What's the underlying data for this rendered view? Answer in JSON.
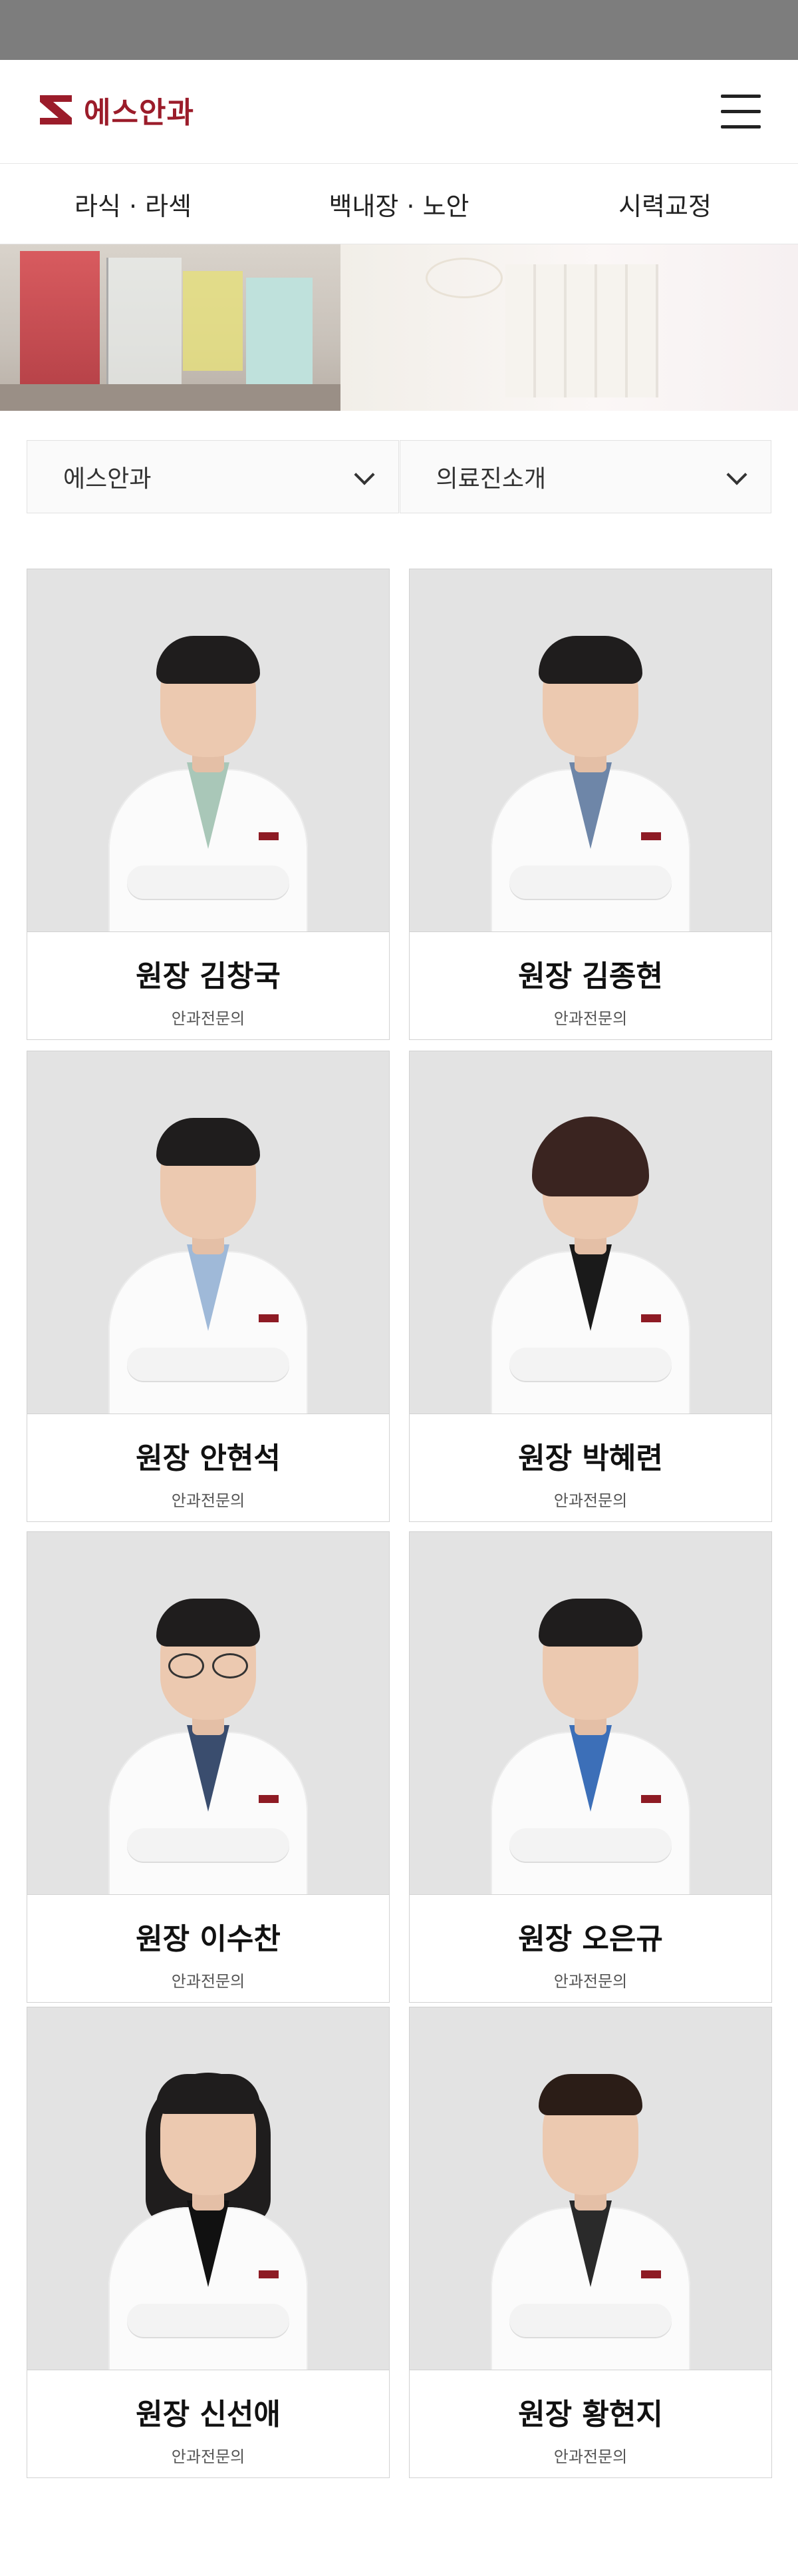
{
  "header": {
    "logo_text": "에스안과",
    "logo_icon": "s-logo-icon",
    "menu_icon": "hamburger-menu-icon"
  },
  "nav": {
    "items": [
      {
        "label": "라식 · 라섹"
      },
      {
        "label": "백내장 · 노안"
      },
      {
        "label": "시력교정"
      }
    ]
  },
  "banner": {
    "image": "clinic-interior-banner"
  },
  "selectors": {
    "hospital": "에스안과",
    "section": "의료진소개"
  },
  "doctors": [
    {
      "name": "원장 김창국",
      "specialty": "안과전문의",
      "shirt": "#a9c7b8",
      "hair": "short"
    },
    {
      "name": "원장 김종현",
      "specialty": "안과전문의",
      "shirt": "#6e86a8",
      "hair": "short"
    },
    {
      "name": "원장 안현석",
      "specialty": "안과전문의",
      "shirt": "#9fb9d8",
      "hair": "short"
    },
    {
      "name": "원장 박혜련",
      "specialty": "안과전문의",
      "shirt": "#1a1a1a",
      "hair": "bob"
    },
    {
      "name": "원장 이수찬",
      "specialty": "안과전문의",
      "shirt": "#3a4d6e",
      "hair": "short-glasses"
    },
    {
      "name": "원장 오은규",
      "specialty": "안과전문의",
      "shirt": "#3c6fb8",
      "hair": "short"
    },
    {
      "name": "원장 신선애",
      "specialty": "안과전문의",
      "shirt": "#111111",
      "hair": "long"
    },
    {
      "name": "원장 황현지",
      "specialty": "안과전문의",
      "shirt": "#2a2a2a",
      "hair": "bun"
    }
  ],
  "colors": {
    "brand": "#9b1c2a",
    "card_border": "#d2d2d2",
    "photo_bg": "#e3e3e3"
  }
}
